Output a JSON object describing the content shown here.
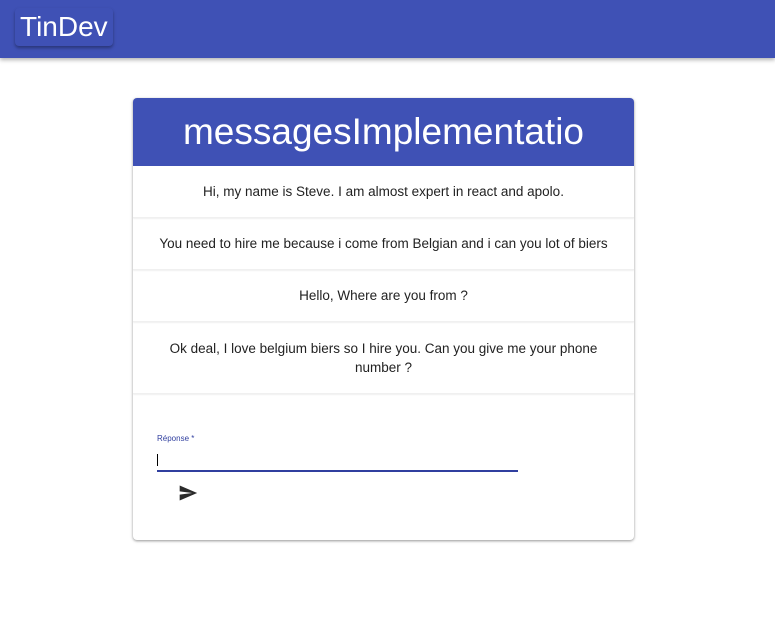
{
  "app": {
    "title": "TinDev"
  },
  "conversation": {
    "title": "messagesImplementatio",
    "messages": [
      "Hi, my name is Steve. I am almost expert in react and apolo.",
      "You need to hire me because i come from Belgian and i can you lot of biers",
      "Hello, Where are you from ?",
      "Ok deal, I love belgium biers so I hire you. Can you give me your phone number ?"
    ]
  },
  "reply": {
    "label": "Réponse *",
    "value": "",
    "send_icon": "send-icon"
  },
  "colors": {
    "primary": "#3f51b5",
    "input_underline": "#303f9f"
  }
}
